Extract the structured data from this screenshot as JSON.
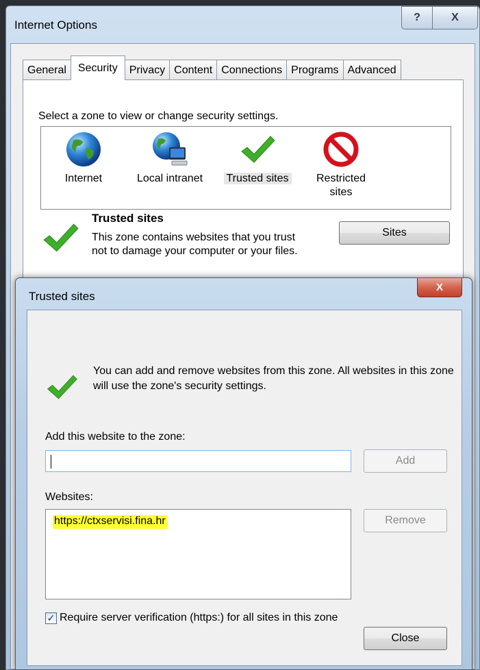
{
  "internet_options": {
    "title": "Internet Options",
    "help_glyph": "?",
    "close_glyph": "X",
    "tabs": [
      {
        "label": "General"
      },
      {
        "label": "Security"
      },
      {
        "label": "Privacy"
      },
      {
        "label": "Content"
      },
      {
        "label": "Connections"
      },
      {
        "label": "Programs"
      },
      {
        "label": "Advanced"
      }
    ],
    "active_tab": "Security",
    "zone_prompt": "Select a zone to view or change security settings.",
    "zones": [
      {
        "label": "Internet",
        "icon": "globe-icon"
      },
      {
        "label": "Local intranet",
        "icon": "globe-computer-icon"
      },
      {
        "label": "Trusted sites",
        "icon": "green-check-icon"
      },
      {
        "label": "Restricted sites",
        "icon": "red-no-icon"
      }
    ],
    "selected_zone": "Trusted sites",
    "zone_title": "Trusted sites",
    "zone_description": "This zone contains websites that you trust not to damage your computer or your files.",
    "sites_button": "Sites"
  },
  "trusted_sites": {
    "title": "Trusted sites",
    "close_glyph": "X",
    "message": "You can add and remove websites from this zone. All websites in this zone will use the zone's security settings.",
    "add_label": "Add this website to the zone:",
    "add_input_value": "",
    "add_button": "Add",
    "websites_label": "Websites:",
    "websites": [
      "https://ctxservisi.fina.hr"
    ],
    "remove_button": "Remove",
    "require_https_label": "Require server verification (https:) for all sites in this zone",
    "require_https_checked": true,
    "close_button": "Close"
  },
  "colors": {
    "highlight": "#ffff33",
    "check_green": "#3fae2a",
    "no_red": "#d4121b"
  }
}
